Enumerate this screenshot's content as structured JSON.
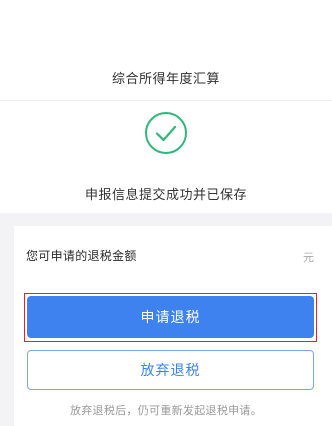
{
  "header": {
    "title": "综合所得年度汇算"
  },
  "result": {
    "icon": "check-circle-icon",
    "message": "申报信息提交成功并已保存"
  },
  "refund": {
    "label": "您可申请的退税金额",
    "unit": "元"
  },
  "actions": {
    "apply_label": "申请退税",
    "abandon_label": "放弃退税",
    "hint": "放弃退税后，仍可重新发起退税申请。"
  },
  "colors": {
    "primary": "#3e82f0",
    "success": "#2fb87a",
    "highlight": "#e0242e",
    "background": "#f3f3f5"
  }
}
